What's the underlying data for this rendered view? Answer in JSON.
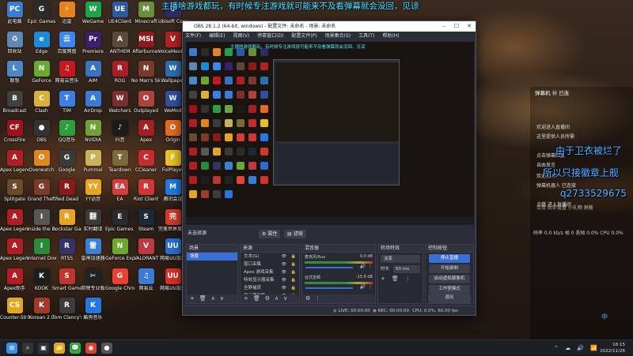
{
  "danmu_text": "主播啥游戏都玩，有时候专注游戏就可能来不及看弹幕就会没回，见谅",
  "desktop_icons": [
    {
      "label": "此电脑",
      "color": "#3a7bd5",
      "glyph": "PC"
    },
    {
      "label": "Epic Games",
      "color": "#2b2b2b",
      "glyph": "G"
    },
    {
      "label": "迅雷",
      "color": "#e8821f",
      "glyph": "⚡"
    },
    {
      "label": "WeGame",
      "color": "#1fa34a",
      "glyph": "W"
    },
    {
      "label": "UE4Client",
      "color": "#2c5aa0",
      "glyph": "UE"
    },
    {
      "label": "Minecraft",
      "color": "#6b8e3a",
      "glyph": "M"
    },
    {
      "label": "Ubisoft Connect",
      "color": "#2d2d5f",
      "glyph": "U"
    },
    {
      "label": "回收站",
      "color": "#5f87b3",
      "glyph": "♻"
    },
    {
      "label": "Edge",
      "color": "#1c8ad6",
      "glyph": "e"
    },
    {
      "label": "百度网盘",
      "color": "#3b86f1",
      "glyph": "云"
    },
    {
      "label": "Premiere",
      "color": "#3a2170",
      "glyph": "Pr"
    },
    {
      "label": "ANTHEM",
      "color": "#5c4a36",
      "glyph": "A"
    },
    {
      "label": "Afterburner",
      "color": "#8f1a1a",
      "glyph": "MSI"
    },
    {
      "label": "VoiceMeeter",
      "color": "#b22222",
      "glyph": "V"
    },
    {
      "label": "联想",
      "color": "#4a88c7",
      "glyph": "L"
    },
    {
      "label": "GeForce",
      "color": "#6aa82f",
      "glyph": "N"
    },
    {
      "label": "网易云音乐",
      "color": "#c8171e",
      "glyph": "♫"
    },
    {
      "label": "AIM",
      "color": "#3a74c1",
      "glyph": "A"
    },
    {
      "label": "ROG",
      "color": "#aa1f26",
      "glyph": "R"
    },
    {
      "label": "No Man's Sky",
      "color": "#7a3a2a",
      "glyph": "N"
    },
    {
      "label": "Wallpaper",
      "color": "#2a6fb5",
      "glyph": "W"
    },
    {
      "label": "Broadcast",
      "color": "#404040",
      "glyph": "B"
    },
    {
      "label": "Clash",
      "color": "#d8b13a",
      "glyph": "C"
    },
    {
      "label": "TIM",
      "color": "#3d7ee6",
      "glyph": "T"
    },
    {
      "label": "AirDrop",
      "color": "#3a7bd5",
      "glyph": "A"
    },
    {
      "label": "Watchers",
      "color": "#7a2e2e",
      "glyph": "W"
    },
    {
      "label": "Outplayed",
      "color": "#b0413e",
      "glyph": "O"
    },
    {
      "label": "WeMod",
      "color": "#314f9e",
      "glyph": "W"
    },
    {
      "label": "CrossFire",
      "color": "#a0111a",
      "glyph": "CF"
    },
    {
      "label": "OBS",
      "color": "#333333",
      "glyph": "●"
    },
    {
      "label": "QQ音乐",
      "color": "#2f9e3d",
      "glyph": "♪"
    },
    {
      "label": "NVIDIA",
      "color": "#70a336",
      "glyph": "N"
    },
    {
      "label": "抖音",
      "color": "#1b1b1b",
      "glyph": "♪"
    },
    {
      "label": "Apex",
      "color": "#a31f25",
      "glyph": "A"
    },
    {
      "label": "Origin",
      "color": "#e56a1f",
      "glyph": "O"
    },
    {
      "label": "Apex Legends",
      "color": "#b01e24",
      "glyph": "A"
    },
    {
      "label": "Overwatch",
      "color": "#e0861f",
      "glyph": "O"
    },
    {
      "label": "Google",
      "color": "#3a3a3a",
      "glyph": "G"
    },
    {
      "label": "Pummel",
      "color": "#c9b25a",
      "glyph": "P"
    },
    {
      "label": "Teardown",
      "color": "#7a6a3a",
      "glyph": "T"
    },
    {
      "label": "CCleaner",
      "color": "#c72c2c",
      "glyph": "C"
    },
    {
      "label": "FolPlayer",
      "color": "#e8c21f",
      "glyph": "F"
    },
    {
      "label": "Splitgate",
      "color": "#6a4a2a",
      "glyph": "S"
    },
    {
      "label": "Grand Theft",
      "color": "#7b3a2a",
      "glyph": "G"
    },
    {
      "label": "Red Dead",
      "color": "#8a1a1a",
      "glyph": "R"
    },
    {
      "label": "YY语音",
      "color": "#e7a51f",
      "glyph": "YY"
    },
    {
      "label": "EA",
      "color": "#d53b3b",
      "glyph": "EA"
    },
    {
      "label": "Riot Client",
      "color": "#d13636",
      "glyph": "R"
    },
    {
      "label": "腾讯会议",
      "color": "#1e7ae6",
      "glyph": "M"
    },
    {
      "label": "Apex Legends",
      "color": "#b01e24",
      "glyph": "A"
    },
    {
      "label": "Inside the Backrooms",
      "color": "#575757",
      "glyph": "I"
    },
    {
      "label": "Rockstar Games",
      "color": "#e6a51f",
      "glyph": "R"
    },
    {
      "label": "实时翻译",
      "color": "#3a3a3a",
      "glyph": "翻"
    },
    {
      "label": "Epic Games Launcher",
      "color": "#2b2b2b",
      "glyph": "E"
    },
    {
      "label": "Steam",
      "color": "#1b2838",
      "glyph": "S"
    },
    {
      "label": "完美世界竞技平台",
      "color": "#cf3a2a",
      "glyph": "完"
    },
    {
      "label": "Apex Legends",
      "color": "#b01e24",
      "glyph": "A"
    },
    {
      "label": "Internet Downloader",
      "color": "#2a8a3a",
      "glyph": "I"
    },
    {
      "label": "RTSS",
      "color": "#333366",
      "glyph": "R"
    },
    {
      "label": "雷神加速器",
      "color": "#3b7fd8",
      "glyph": "雷"
    },
    {
      "label": "GeForce Experience",
      "color": "#6aa82f",
      "glyph": "N"
    },
    {
      "label": "VALORANT",
      "color": "#bd3944",
      "glyph": "V"
    },
    {
      "label": "网易UU加速",
      "color": "#2a6fd0",
      "glyph": "UU"
    },
    {
      "label": "Apex助手",
      "color": "#b01e24",
      "glyph": "A"
    },
    {
      "label": "KOOK",
      "color": "#1d1d1d",
      "glyph": "K"
    },
    {
      "label": "Smart Game Booster",
      "color": "#c2342f",
      "glyph": "S"
    },
    {
      "label": "剪映专业版",
      "color": "#222222",
      "glyph": "✂"
    },
    {
      "label": "Google Chrome",
      "color": "#e84234",
      "glyph": "G"
    },
    {
      "label": "网易云",
      "color": "#3a7bd5",
      "glyph": "♫"
    },
    {
      "label": "网易UU加速",
      "color": "#d8312a",
      "glyph": "UU"
    },
    {
      "label": "Counter-Strike Global Off.",
      "color": "#e6a51f",
      "glyph": "CS"
    },
    {
      "label": "Korean 2.0",
      "color": "#a03a2a",
      "glyph": "K"
    },
    {
      "label": "Tom Clancy's R.",
      "color": "#3c3c3c",
      "glyph": "R"
    },
    {
      "label": "酷狗音乐",
      "color": "#2377e0",
      "glyph": "K"
    }
  ],
  "obs": {
    "title": "OBS 28.1.2 (64-bit, windows) - 配置文件: 未命名 - 场景: 未命名",
    "menu": [
      "文件(F)",
      "编辑(E)",
      "视图(V)",
      "停靠窗口(D)",
      "配置文件(P)",
      "场景集合(S)",
      "工具(T)",
      "帮助(H)"
    ],
    "no_source": "未选择源",
    "props_btn": "属性",
    "filters_btn": "滤镜",
    "scenes": {
      "header": "场景",
      "items": [
        "场景"
      ]
    },
    "sources": {
      "header": "来源",
      "items": [
        "文本(G)",
        "窗口采集",
        "Apex 游戏采集",
        "特效显示器采集",
        "全屏捕获",
        "显示器采集"
      ]
    },
    "mixer": {
      "header": "混音器",
      "tracks": [
        {
          "name": "麦克风/Aux",
          "db": "0.0 dB",
          "level": 0.6
        },
        {
          "name": "台式音频",
          "db": "-15.6 dB",
          "level": 0.55
        }
      ]
    },
    "transitions": {
      "header": "转场特效",
      "type": "淡变",
      "duration_label": "时长",
      "duration": "50 ms"
    },
    "controls": {
      "header": "控制按钮",
      "buttons": [
        "停止直播",
        "开始录制",
        "启动虚拟摄像机",
        "工作室模式",
        "设置",
        "退出"
      ]
    },
    "status": {
      "live": "LIVE: 00:00:00",
      "rec": "REC: 00:00:00",
      "cpu": "CPU: 0.0%, 60.00 fps"
    }
  },
  "chat": {
    "rows": [
      "弹幕机 Ⓜ 已连",
      "欢迎来到直播间",
      "欢迎进入直播间",
      "这里提供人员所需",
      "点击弹幕回复",
      "自由发言",
      "欢迎加入",
      "弹幕机器人 已连接",
      "加入弹幕助手成功",
      "点燃 进入直播间",
      "点赞 助手设置 小礼物 屏蔽"
    ],
    "big1": "由于卫衣被烂了",
    "big2": "所以只接徽章上舰",
    "big3": "q2733529675",
    "num": "2733529675",
    "stats": "码率 0.0 kb/s  帧 0  丢帧 0.0%  CPU 0.0%",
    "datetime": "16:15\n2022/11/26"
  },
  "taskbar_icons": [
    "windows-icon",
    "search-icon",
    "task-view-icon",
    "file-explorer-icon",
    "wechat-icon",
    "chrome-icon",
    "obs-icon"
  ],
  "taskbar_time": "16:15",
  "taskbar_date": "2022/11/26",
  "tray_lang": "中"
}
